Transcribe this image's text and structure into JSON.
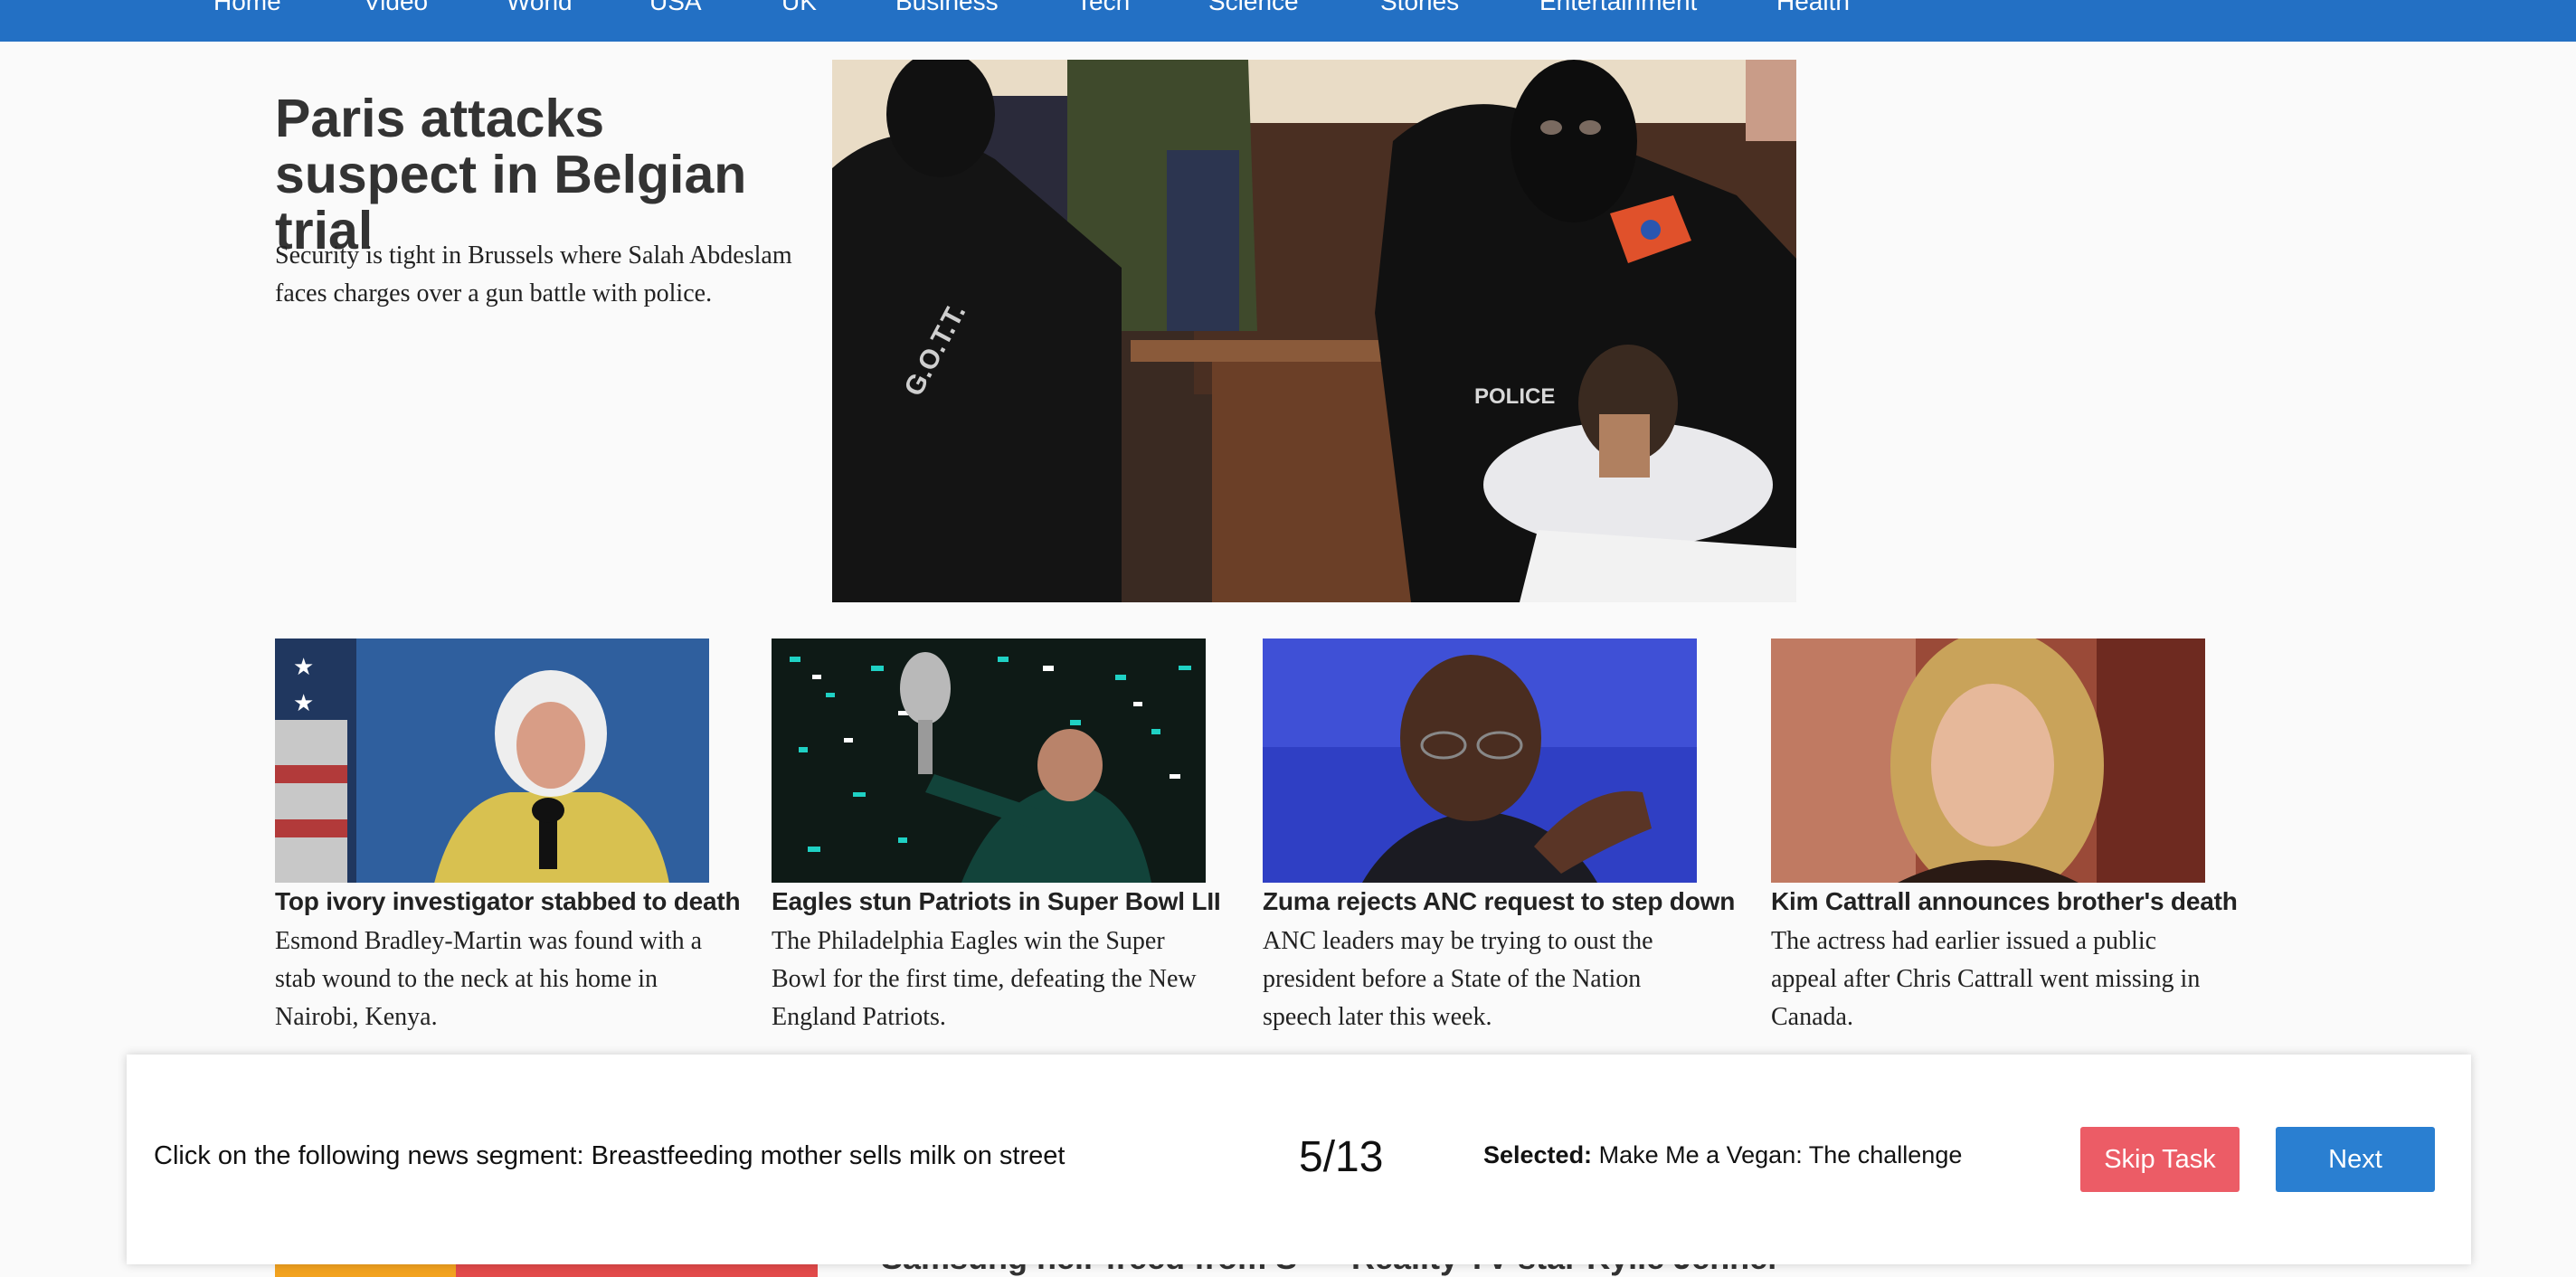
{
  "nav": {
    "items": [
      "Home",
      "Video",
      "World",
      "USA",
      "UK",
      "Business",
      "Tech",
      "Science",
      "Stories",
      "Entertainment",
      "Health"
    ]
  },
  "hero": {
    "title": "Paris attacks suspect in Belgian trial",
    "description": "Security is tight in Brussels where Salah Abdeslam faces charges over a gun battle with police.",
    "image_text": {
      "sleeve": "G.O.T.T.",
      "vest": "POLICE"
    }
  },
  "stories": [
    {
      "title": "Top ivory investigator stabbed to death",
      "description": "Esmond Bradley-Martin was found with a stab wound to the neck at his home in Nairobi, Kenya."
    },
    {
      "title": "Eagles stun Patriots in Super Bowl LII",
      "description": "The Philadelphia Eagles win the Super Bowl for the first time, defeating the New England Patriots."
    },
    {
      "title": "Zuma rejects ANC request to step down",
      "description": "ANC leaders may be trying to oust the president before a State of the Nation speech later this week."
    },
    {
      "title": "Kim Cattrall announces brother's death",
      "description": "The actress had earlier issued a public appeal after Chris Cattrall went missing in Canada."
    }
  ],
  "next_row": {
    "title_a": "Samsung heir freed from S",
    "title_b": "Reality TV star Kylie Jenner"
  },
  "task": {
    "instruction": "Click on the following news segment: Breastfeeding mother sells milk on street",
    "progress": "5/13",
    "selected_label": "Selected:",
    "selected_value": "Make Me a Vegan: The challenge",
    "skip_label": "Skip Task",
    "next_label": "Next"
  },
  "colors": {
    "nav_bg": "#2370c4",
    "skip_button": "#ec5c66",
    "next_button": "#2a7fd1"
  }
}
